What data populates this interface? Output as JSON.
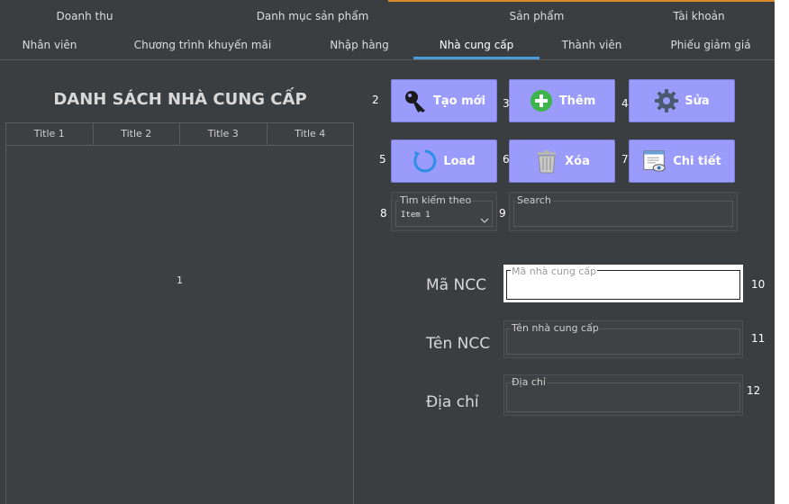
{
  "tabs_row1": [
    "Doanh thu",
    "Danh mục sản phẩm",
    "Sản phẩm",
    "Tài khoản"
  ],
  "tabs_row2": [
    "Nhân viên",
    "Chương trình khuyến mãi",
    "Nhập hàng",
    "Nhà cung cấp",
    "Thành viên",
    "Phiếu giảm giá"
  ],
  "active_tab": "Nhà cung cấp",
  "accent_color": "#4a9bd8",
  "button_color": "#9a9bfa",
  "page_title": "DANH SÁCH NHÀ CUNG CẤP",
  "table": {
    "headers": [
      "Title 1",
      "Title 2",
      "Title 3",
      "Title 4"
    ],
    "body_label": "1"
  },
  "buttons": {
    "create": {
      "num": "2",
      "label": "Tạo mới",
      "icon": "key-icon"
    },
    "add": {
      "num": "3",
      "label": "Thêm",
      "icon": "plus-circle-icon"
    },
    "edit": {
      "num": "4",
      "label": "Sửa",
      "icon": "gear-icon"
    },
    "load": {
      "num": "5",
      "label": "Load",
      "icon": "refresh-icon"
    },
    "delete": {
      "num": "6",
      "label": "Xóa",
      "icon": "trash-icon"
    },
    "detail": {
      "num": "7",
      "label": "Chi tiết",
      "icon": "view-details-icon"
    }
  },
  "search": {
    "combo_num": "8",
    "combo_label": "Tìm kiếm theo",
    "combo_value": "Item 1",
    "search_num": "9",
    "search_label": "Search"
  },
  "form": {
    "ma_label": "Mã NCC",
    "ma_placeholder": "Mã nhà cung cấp",
    "ma_num": "10",
    "ten_label": "Tên NCC",
    "ten_placeholder": "Tên nhà cung cấp",
    "ten_num": "11",
    "diachi_label": "Địa chỉ",
    "diachi_placeholder": "Địa chỉ",
    "diachi_num": "12"
  }
}
